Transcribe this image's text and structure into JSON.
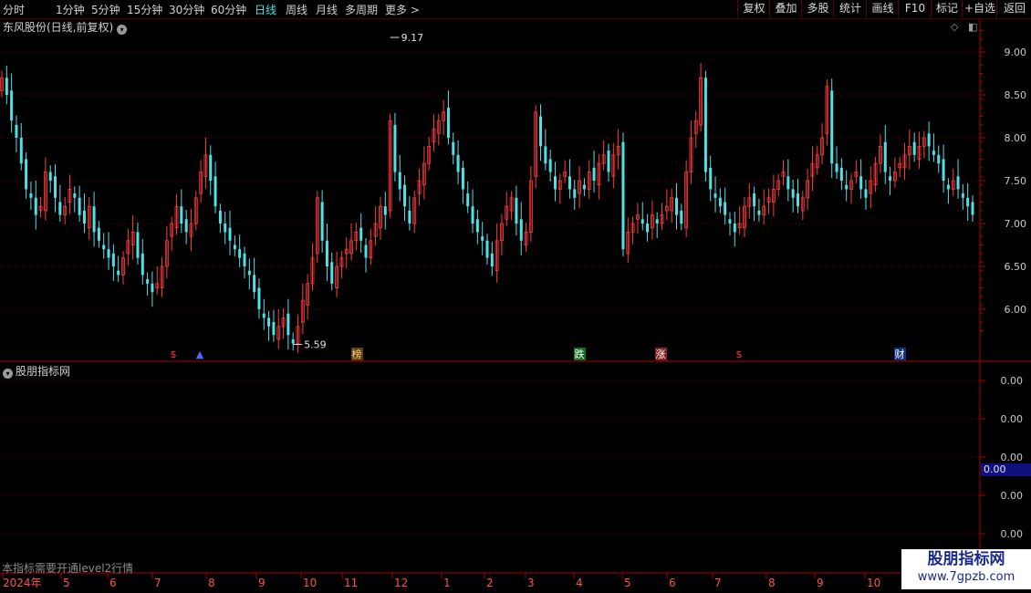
{
  "toolbar": {
    "periods": [
      "分时",
      "1分钟",
      "5分钟",
      "15分钟",
      "30分钟",
      "60分钟",
      "日线",
      "周线",
      "月线",
      "多周期",
      "更多 >"
    ],
    "active_period": "日线",
    "tools": [
      "复权",
      "叠加",
      "多股",
      "统计",
      "画线",
      "F10",
      "标记",
      "+自选",
      "返回"
    ]
  },
  "stock": {
    "title": "东风股份(日线,前复权)"
  },
  "indicator": {
    "title": "股朋指标网",
    "note": "本指标需要开通level2行情",
    "current_value": "0.00"
  },
  "watermark": {
    "line1": "股朋指标网",
    "line2": "www.7gpzb.com"
  },
  "colors": {
    "up": "#ff3c3c",
    "down": "#50e0e8",
    "grid": "#7a0000",
    "axis": "#b00000"
  },
  "chart_data": {
    "type": "candlestick",
    "price_axis": {
      "min": 5.4,
      "max": 9.4,
      "ticks": [
        6.0,
        6.5,
        7.0,
        7.5,
        8.0,
        8.5,
        9.0
      ],
      "labels": [
        "6.00",
        "6.50",
        "7.00",
        "7.50",
        "8.00",
        "8.50",
        "9.00"
      ]
    },
    "indicator_axis": {
      "labels": [
        "0.00",
        "0.00",
        "0.00",
        "0.00",
        "0.00"
      ]
    },
    "time_axis": [
      "2024年",
      "5",
      "6",
      "7",
      "8",
      "9",
      "10",
      "11",
      "12",
      "1",
      "2",
      "3",
      "4",
      "5",
      "6",
      "7",
      "8",
      "9",
      "10"
    ],
    "annotations": [
      {
        "label": "9.17",
        "value": 9.17,
        "kind": "high"
      },
      {
        "label": "5.59",
        "value": 5.59,
        "kind": "low"
      }
    ],
    "markers": [
      {
        "label": "$",
        "color": "#ff3c3c"
      },
      {
        "label": "▲",
        "color": "#4a6aff"
      },
      {
        "label": "榜",
        "color": "#ffd080"
      },
      {
        "label": "跌",
        "color": "#ffffff"
      },
      {
        "label": "涨",
        "color": "#ffffff"
      },
      {
        "label": "$",
        "color": "#ff3c3c"
      },
      {
        "label": "财",
        "color": "#ffffff"
      }
    ],
    "closes": [
      8.7,
      8.5,
      8.2,
      8.0,
      7.7,
      7.4,
      7.3,
      7.1,
      7.2,
      7.6,
      7.5,
      7.3,
      7.1,
      7.2,
      7.4,
      7.3,
      7.1,
      7.0,
      7.2,
      6.9,
      6.8,
      6.7,
      6.6,
      6.5,
      6.4,
      6.6,
      6.8,
      6.9,
      6.6,
      6.4,
      6.3,
      6.2,
      6.3,
      6.5,
      6.8,
      7.0,
      7.2,
      7.0,
      6.9,
      7.0,
      7.3,
      7.6,
      7.8,
      7.5,
      7.2,
      7.0,
      6.9,
      6.8,
      6.7,
      6.6,
      6.5,
      6.4,
      6.2,
      6.0,
      5.9,
      5.8,
      5.7,
      5.8,
      5.9,
      5.7,
      5.6,
      5.8,
      6.1,
      6.3,
      6.6,
      7.3,
      6.8,
      6.5,
      6.3,
      6.5,
      6.6,
      6.7,
      6.8,
      6.9,
      6.8,
      6.6,
      6.8,
      7.0,
      7.2,
      7.1,
      8.2,
      7.6,
      7.4,
      7.2,
      7.0,
      7.3,
      7.5,
      7.7,
      7.9,
      8.1,
      8.2,
      8.3,
      8.0,
      7.8,
      7.6,
      7.4,
      7.2,
      7.0,
      6.9,
      6.8,
      6.6,
      6.5,
      6.8,
      7.0,
      7.2,
      7.3,
      7.0,
      6.8,
      6.9,
      7.5,
      8.3,
      7.9,
      7.7,
      7.6,
      7.4,
      7.5,
      7.6,
      7.4,
      7.3,
      7.5,
      7.4,
      7.6,
      7.5,
      7.7,
      7.8,
      7.6,
      7.8,
      7.9,
      6.7,
      6.9,
      7.0,
      7.1,
      7.0,
      6.9,
      7.1,
      7.0,
      7.1,
      7.2,
      7.3,
      7.1,
      7.0,
      7.6,
      8.0,
      8.2,
      8.7,
      7.6,
      7.4,
      7.3,
      7.2,
      7.1,
      7.0,
      6.9,
      7.0,
      7.2,
      7.3,
      7.2,
      7.1,
      7.2,
      7.3,
      7.4,
      7.5,
      7.6,
      7.4,
      7.3,
      7.2,
      7.3,
      7.5,
      7.7,
      7.8,
      8.0,
      8.6,
      7.7,
      7.6,
      7.5,
      7.4,
      7.5,
      7.6,
      7.4,
      7.3,
      7.5,
      7.7,
      7.9,
      7.6,
      7.5,
      7.6,
      7.7,
      7.8,
      7.9,
      7.8,
      7.9,
      8.0,
      7.9,
      7.8,
      7.7,
      7.5,
      7.4,
      7.5,
      7.4,
      7.3,
      7.2,
      7.1
    ]
  }
}
